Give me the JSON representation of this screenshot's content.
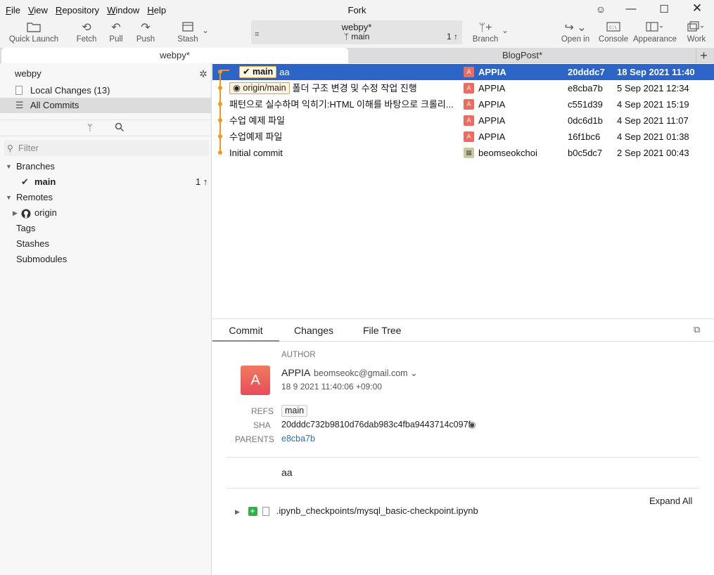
{
  "menu": [
    "File",
    "View",
    "Repository",
    "Window",
    "Help"
  ],
  "menu_underline": [
    "F",
    "V",
    "R",
    "W",
    "H"
  ],
  "menu_rest": [
    "ile",
    "iew",
    "epository",
    "indow",
    "elp"
  ],
  "window": {
    "title": "Fork"
  },
  "toolbar": {
    "quick_launch": "Quick Launch",
    "fetch": "Fetch",
    "pull": "Pull",
    "push": "Push",
    "stash": "Stash",
    "repo_name": "webpy*",
    "current_branch": "main",
    "ahead": "1 ↑",
    "branch": "Branch",
    "open_in": "Open in",
    "console": "Console",
    "appearance": "Appearance",
    "work": "Work"
  },
  "tabs": [
    {
      "label": "webpy*",
      "active": true
    },
    {
      "label": "BlogPost*",
      "active": false
    }
  ],
  "sidebar": {
    "repo": "webpy",
    "local_changes": "Local Changes (13)",
    "all_commits": "All Commits",
    "filter_placeholder": "Filter",
    "branches_header": "Branches",
    "branch_main": "main",
    "branch_main_ahead": "1 ↑",
    "remotes_header": "Remotes",
    "remote_origin": "origin",
    "tags": "Tags",
    "stashes": "Stashes",
    "submodules": "Submodules"
  },
  "commits": [
    {
      "ref": "main",
      "message": "aa",
      "author_initial": "A",
      "author": "APPIA",
      "sha": "20dddc7",
      "date": "18 Sep 2021 11:40"
    },
    {
      "ref": "origin/main",
      "message": "폴더 구조 변경 및 수정 작업 진행",
      "author_initial": "A",
      "author": "APPIA",
      "sha": "e8cba7b",
      "date": "5 Sep 2021 12:34"
    },
    {
      "ref": "",
      "message": "패턴으로 실수하며 익히기:HTML 이해를 바탕으로 크롤리...",
      "author_initial": "A",
      "author": "APPIA",
      "sha": "c551d39",
      "date": "4 Sep 2021 15:19"
    },
    {
      "ref": "",
      "message": "수업 예제 파일",
      "author_initial": "A",
      "author": "APPIA",
      "sha": "0dc6d1b",
      "date": "4 Sep 2021 11:07"
    },
    {
      "ref": "",
      "message": "수업예제 파일",
      "author_initial": "A",
      "author": "APPIA",
      "sha": "16f1bc6",
      "date": "4 Sep 2021 01:38"
    },
    {
      "ref": "",
      "message": "Initial commit",
      "author_initial": "",
      "author": "beomseokchoi",
      "sha": "b0c5dc7",
      "date": "2 Sep 2021 00:43"
    }
  ],
  "detail": {
    "tabs": [
      "Commit",
      "Changes",
      "File Tree"
    ],
    "author_label": "AUTHOR",
    "author_initial": "A",
    "author_name": "APPIA",
    "author_email": "beomseokc@gmail.com",
    "author_date": "18 9 2021 11:40:06 +09:00",
    "refs_label": "REFS",
    "refs_value": "main",
    "sha_label": "SHA",
    "sha_value": "20dddc732b9810d76dab983c4fba9443714c097f",
    "parents_label": "PARENTS",
    "parents_value": "e8cba7b",
    "message": "aa",
    "expand_all": "Expand All",
    "file": ".ipynb_checkpoints/mysql_basic-checkpoint.ipynb"
  }
}
